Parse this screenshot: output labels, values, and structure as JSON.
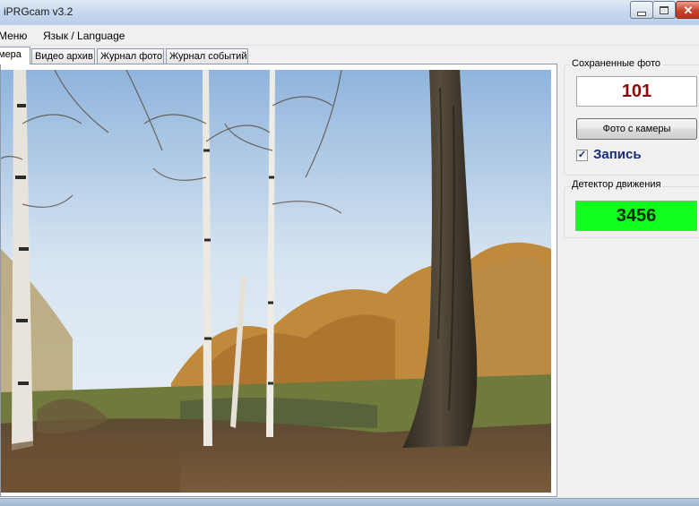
{
  "window": {
    "title": "iPRGcam v3.2"
  },
  "menu": {
    "items": [
      "Меню",
      "Язык / Language"
    ]
  },
  "tabs": [
    {
      "label": "Камера",
      "visible_label": "мера",
      "active": true
    },
    {
      "label": "Видео архив",
      "active": false
    },
    {
      "label": "Журнал фото",
      "active": false
    },
    {
      "label": "Журнал событий",
      "active": false
    }
  ],
  "saved_photos": {
    "group_label": "Сохраненные фото",
    "count": "101",
    "camera_button_label": "Фото с камеры",
    "record_label": "Запись",
    "record_checked": true
  },
  "motion_detector": {
    "group_label": "Детектор движения",
    "value": "3456",
    "color": "#0fff20"
  },
  "colors": {
    "count_text": "#8b0a0a",
    "record_text": "#172a78"
  }
}
